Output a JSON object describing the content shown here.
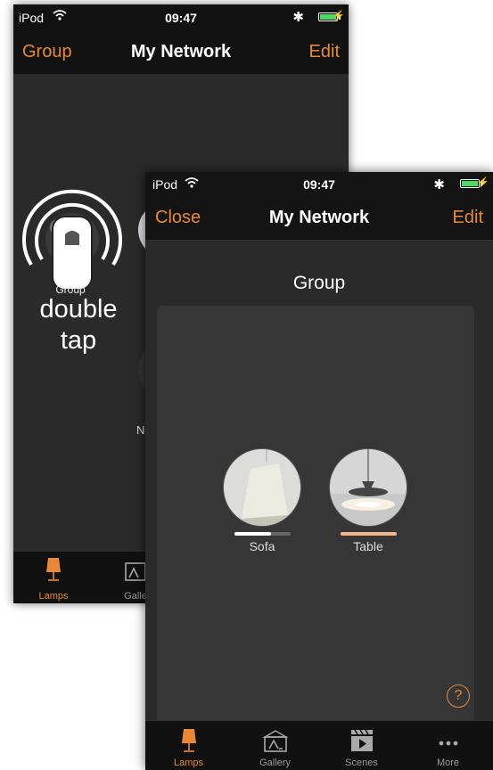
{
  "back_screen": {
    "status_bar": {
      "carrier": "iPod",
      "time": "09:47"
    },
    "nav": {
      "left": "Group",
      "title": "My Network",
      "right": "Edit"
    },
    "group_label": "Group",
    "hint_line1": "double",
    "hint_line2": "tap",
    "partial_label": "N",
    "tabs": [
      {
        "label": "Lamps"
      },
      {
        "label": "Galle"
      }
    ]
  },
  "front_screen": {
    "status_bar": {
      "carrier": "iPod",
      "time": "09:47"
    },
    "nav": {
      "left": "Close",
      "title": "My Network",
      "right": "Edit"
    },
    "section_title": "Group",
    "lamps": [
      {
        "name": "Sofa",
        "level": 0.65
      },
      {
        "name": "Table",
        "level": 1.0
      }
    ],
    "help_symbol": "?",
    "tabs": [
      {
        "label": "Lamps"
      },
      {
        "label": "Gallery"
      },
      {
        "label": "Scenes"
      },
      {
        "label": "More"
      }
    ]
  },
  "colors": {
    "accent": "#e8893a",
    "warm_bar": "#f0b88a",
    "background": "#2a2a2a"
  }
}
